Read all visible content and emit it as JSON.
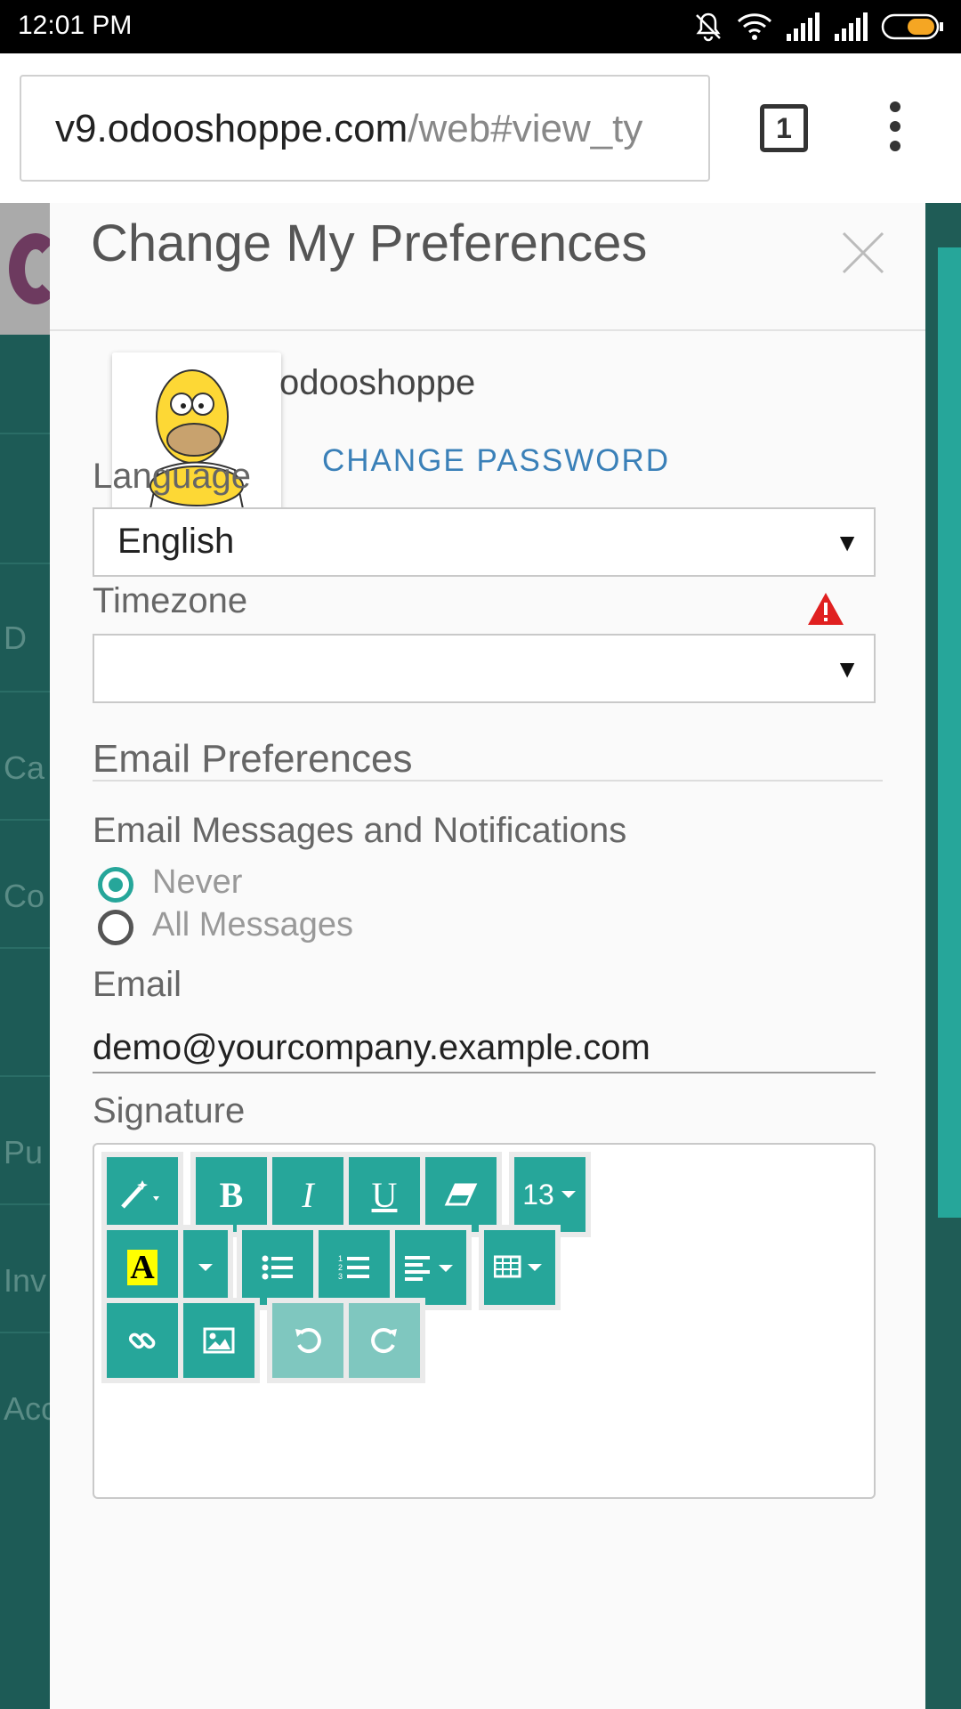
{
  "status_bar": {
    "time": "12:01 PM"
  },
  "browser": {
    "url_host": "v9.odooshoppe.com",
    "url_path": "/web#view_ty",
    "tab_count": "1"
  },
  "background": {
    "left_items": [
      "D",
      "Ca",
      "Co",
      "Pu",
      "Inv",
      "Acc"
    ]
  },
  "dialog": {
    "title": "Change My Preferences",
    "user_name": "odooshoppe",
    "change_password_label": "CHANGE PASSWORD",
    "language_label": "Language",
    "language_value": "English",
    "timezone_label": "Timezone",
    "timezone_value": "",
    "email_prefs_heading": "Email Preferences",
    "notifications_label": "Email Messages and Notifications",
    "notification_options": [
      {
        "label": "Never",
        "selected": true
      },
      {
        "label": "All Messages",
        "selected": false
      }
    ],
    "email_label": "Email",
    "email_value": "demo@yourcompany.example.com",
    "signature_label": "Signature",
    "toolbar": {
      "bold_label": "B",
      "italic_label": "I",
      "underline_label": "U",
      "font_size": "13",
      "font_color_label": "A"
    }
  },
  "colors": {
    "accent": "#26a69a",
    "link": "#3a80b8",
    "warning": "#e02020"
  }
}
